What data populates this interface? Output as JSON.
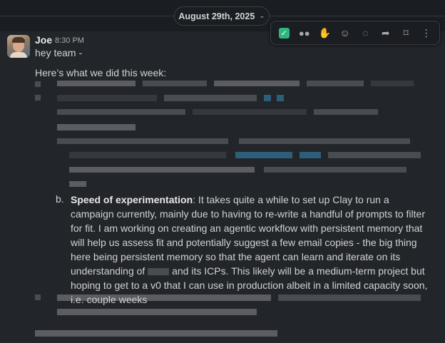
{
  "date_divider": {
    "label": "August 29th, 2025"
  },
  "message": {
    "sender": "Joe",
    "time": "8:30 PM",
    "greeting": "hey team -",
    "intro": "Here’s what we did this week:",
    "item_b": {
      "marker": "b.",
      "title": "Speed of experimentation",
      "text_before": ": It takes quite a while to set up Clay to run a campaign currently, mainly due to having to re-write a handful of prompts to filter for fit. I am working on creating an agentic workflow with persistent memory that will help us assess fit and potentially suggest a few email copies - the big thing here being persistent memory so that the agent can learn and iterate on its understanding of ",
      "text_after": " and its ICPs. This likely will be a medium-term project but hoping to get to a v0 that I can use in production albeit in a limited capacity soon, i.e. couple weeks"
    }
  },
  "toolbar": {
    "buttons": [
      {
        "name": "completed-reaction-button",
        "glyph": "✓"
      },
      {
        "name": "eyes-reaction-button",
        "glyph": "👀"
      },
      {
        "name": "raised-hands-reaction-button",
        "glyph": "🙌"
      },
      {
        "name": "add-reaction-button",
        "glyph": "☺"
      },
      {
        "name": "reply-in-thread-button",
        "glyph": "💬"
      },
      {
        "name": "share-message-button",
        "glyph": "➦"
      },
      {
        "name": "save-message-button",
        "glyph": "🔖"
      },
      {
        "name": "more-actions-button",
        "glyph": "⋮"
      }
    ]
  }
}
